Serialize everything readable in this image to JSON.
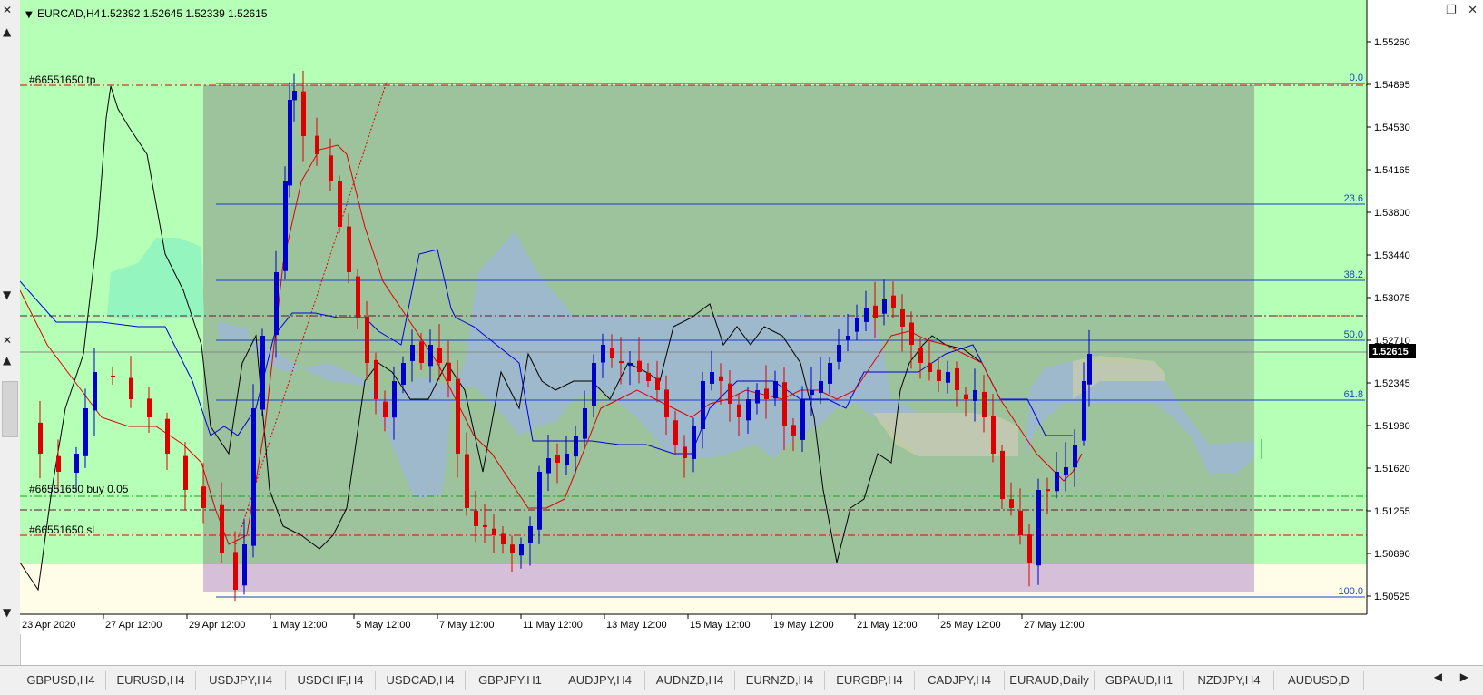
{
  "window": {
    "symbol_title": "EURCAD,H4",
    "ohlc": "1.52392 1.52645 1.52339 1.52615",
    "dropdown_glyph": "▼",
    "close_glyph": "✕",
    "restore_glyph": "❐",
    "strip_close_glyph": "✕",
    "strip_up_glyph": "▲",
    "strip_down_glyph": "▼"
  },
  "trade_labels": {
    "tp": "#66551650 tp",
    "buy": "#66551650 buy 0.05",
    "sl": "#66551650 sl"
  },
  "fib_levels": [
    {
      "label": "0.0",
      "price": 1.549
    },
    {
      "label": "23.6",
      "price": 1.5387
    },
    {
      "label": "38.2",
      "price": 1.5322
    },
    {
      "label": "50.0",
      "price": 1.5271
    },
    {
      "label": "61.8",
      "price": 1.522
    },
    {
      "label": "100.0",
      "price": 1.5052
    }
  ],
  "price_axis": {
    "ticks": [
      "1.55260",
      "1.54895",
      "1.54530",
      "1.54165",
      "1.53800",
      "1.53440",
      "1.53075",
      "1.52710",
      "1.52345",
      "1.51980",
      "1.51620",
      "1.51255",
      "1.50890",
      "1.50525"
    ],
    "current_price": "1.52615"
  },
  "time_axis": {
    "labels": [
      "23 Apr 2020",
      "27 Apr 12:00",
      "29 Apr 12:00",
      "1 May 12:00",
      "5 May 12:00",
      "7 May 12:00",
      "11 May 12:00",
      "13 May 12:00",
      "15 May 12:00",
      "19 May 12:00",
      "21 May 12:00",
      "25 May 12:00",
      "27 May 12:00"
    ]
  },
  "colors": {
    "bg_green": "#b6ffb6",
    "bg_cream": "#fffde8",
    "fib_zone": "#9cc39c",
    "purple_zone": "#d6bfd9",
    "bull": "#0000cc",
    "bear": "#dd0000",
    "fib_line": "#1a3fcc",
    "kumo_blue": "#9db8d0",
    "kumo_light": "#c9ccaa",
    "kumo_mint": "#8ef5c0"
  },
  "tabs": [
    "GBPUSD,H4",
    "EURUSD,H4",
    "USDJPY,H4",
    "USDCHF,H4",
    "USDCAD,H4",
    "GBPJPY,H1",
    "AUDJPY,H4",
    "AUDNZD,H4",
    "EURNZD,H4",
    "EURGBP,H4",
    "CADJPY,H4",
    "EURAUD,Daily",
    "GBPAUD,H1",
    "NZDJPY,H4",
    "AUDUSD,D"
  ],
  "tab_arrows": "◀ ▶"
}
